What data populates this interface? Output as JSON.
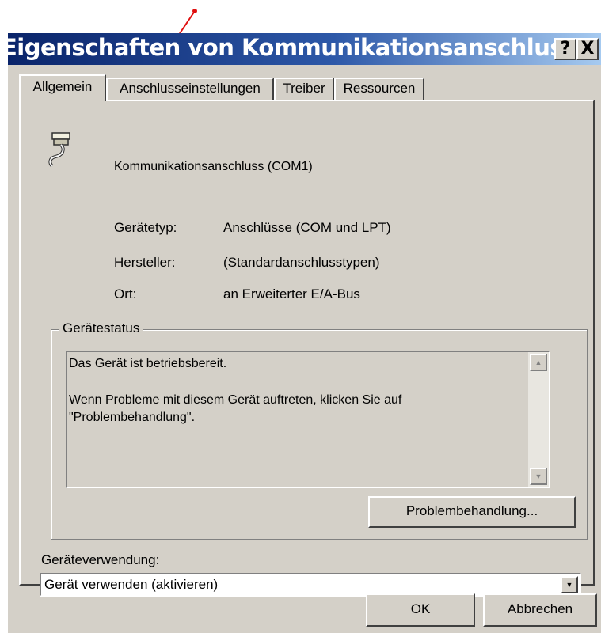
{
  "window": {
    "title": "Eigenschaften von Kommunikationsanschluss ...",
    "help_label": "?",
    "close_label": "X"
  },
  "tabs": [
    {
      "label": "Allgemein",
      "active": true
    },
    {
      "label": "Anschlusseinstellungen",
      "active": false
    },
    {
      "label": "Treiber",
      "active": false
    },
    {
      "label": "Ressourcen",
      "active": false
    }
  ],
  "device": {
    "icon": "serial-port-icon",
    "name": "Kommunikationsanschluss (COM1)"
  },
  "properties": [
    {
      "label": "Gerätetyp:",
      "value": "Anschlüsse (COM und LPT)"
    },
    {
      "label": "Hersteller:",
      "value": "(Standardanschlusstypen)"
    },
    {
      "label": "Ort:",
      "value": "an Erweiterter E/A-Bus"
    }
  ],
  "status": {
    "group_title": "Gerätestatus",
    "line1": "Das Gerät ist betriebsbereit.",
    "line2": "Wenn Probleme mit diesem Gerät auftreten, klicken Sie auf \"Problembehandlung\".",
    "troubleshoot_label": "Problembehandlung..."
  },
  "usage": {
    "label": "Geräteverwendung:",
    "selected": "Gerät verwenden (aktivieren)"
  },
  "buttons": {
    "ok": "OK",
    "cancel": "Abbrechen"
  },
  "colors": {
    "title_bar_start": "#0a246a",
    "title_bar_end": "#a6caf0",
    "face": "#d4d0c8",
    "annotation_arrow": "#e01010"
  }
}
